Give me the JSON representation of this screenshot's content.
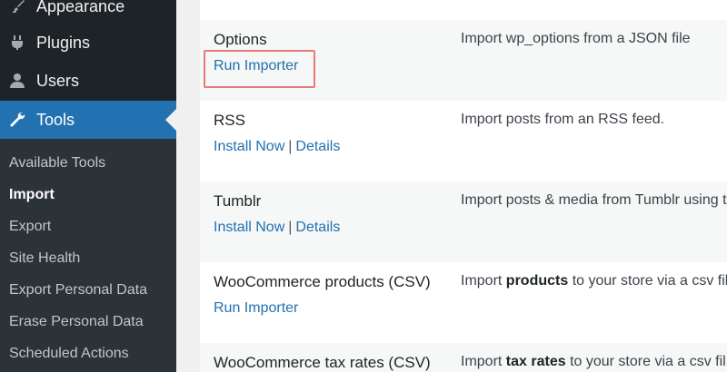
{
  "sidebar": {
    "menu": [
      {
        "label": "Appearance",
        "icon": "appearance-icon"
      },
      {
        "label": "Plugins",
        "icon": "plugins-icon"
      },
      {
        "label": "Users",
        "icon": "users-icon"
      },
      {
        "label": "Tools",
        "icon": "tools-icon",
        "active": true
      }
    ],
    "submenu": [
      {
        "label": "Available Tools"
      },
      {
        "label": "Import",
        "current": true
      },
      {
        "label": "Export"
      },
      {
        "label": "Site Health"
      },
      {
        "label": "Export Personal Data"
      },
      {
        "label": "Erase Personal Data"
      },
      {
        "label": "Scheduled Actions"
      }
    ]
  },
  "importers": [
    {
      "name": "Options",
      "action1": "Run Importer",
      "desc": "Import wp_options from a JSON file"
    },
    {
      "name": "RSS",
      "action1": "Install Now",
      "sep": "|",
      "action2": "Details",
      "desc": "Import posts from an RSS feed."
    },
    {
      "name": "Tumblr",
      "action1": "Install Now",
      "sep": "|",
      "action2": "Details",
      "desc": "Import posts & media from Tumblr using t"
    },
    {
      "name": "WooCommerce products (CSV)",
      "action1": "Run Importer",
      "desc_pre": "Import ",
      "desc_bold": "products",
      "desc_post": " to your store via a csv fil"
    },
    {
      "name": "WooCommerce tax rates (CSV)",
      "desc_pre": "Import ",
      "desc_bold": "tax rates",
      "desc_post": " to your store via a csv fil"
    }
  ],
  "colors": {
    "accent": "#2271b1",
    "sidebar": "#1d2327",
    "highlight": "#e97a7a"
  }
}
